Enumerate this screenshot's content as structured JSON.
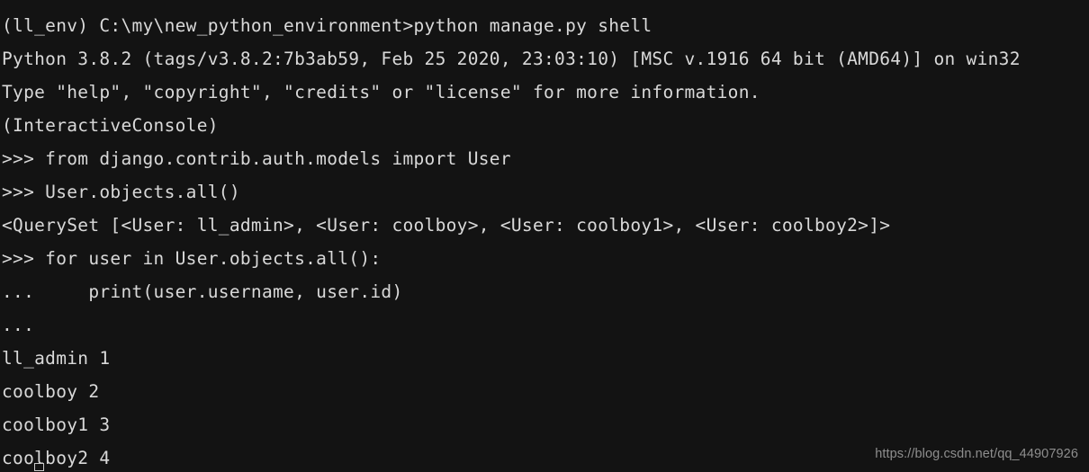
{
  "terminal": {
    "background_color": "#131313",
    "text_color": "#d9d9d9",
    "cursor": {
      "name": "text-cursor",
      "style": "hollow-block"
    },
    "lines": [
      {
        "id": "prompt-command",
        "text": "(ll_env) C:\\my\\new_python_environment>python manage.py shell"
      },
      {
        "id": "python-version",
        "text": "Python 3.8.2 (tags/v3.8.2:7b3ab59, Feb 25 2020, 23:03:10) [MSC v.1916 64 bit (AMD64)] on win32"
      },
      {
        "id": "python-help-notice",
        "text": "Type \"help\", \"copyright\", \"credits\" or \"license\" for more information."
      },
      {
        "id": "interactive-console",
        "text": "(InteractiveConsole)"
      },
      {
        "id": "input-import-user",
        "text": ">>> from django.contrib.auth.models import User"
      },
      {
        "id": "input-user-objects-all",
        "text": ">>> User.objects.all()"
      },
      {
        "id": "output-queryset",
        "text": "<QuerySet [<User: ll_admin>, <User: coolboy>, <User: coolboy1>, <User: coolboy2>]>"
      },
      {
        "id": "input-for-loop",
        "text": ">>> for user in User.objects.all():"
      },
      {
        "id": "input-print-stmt",
        "text": "...     print(user.username, user.id)"
      },
      {
        "id": "input-loop-end",
        "text": "..."
      },
      {
        "id": "output-user-1",
        "text": "ll_admin 1"
      },
      {
        "id": "output-user-2",
        "text": "coolboy 2"
      },
      {
        "id": "output-user-3",
        "text": "coolboy1 3"
      },
      {
        "id": "output-user-4",
        "text": "coolboy2 4"
      }
    ]
  },
  "watermark": {
    "text": "https://blog.csdn.net/qq_44907926"
  }
}
